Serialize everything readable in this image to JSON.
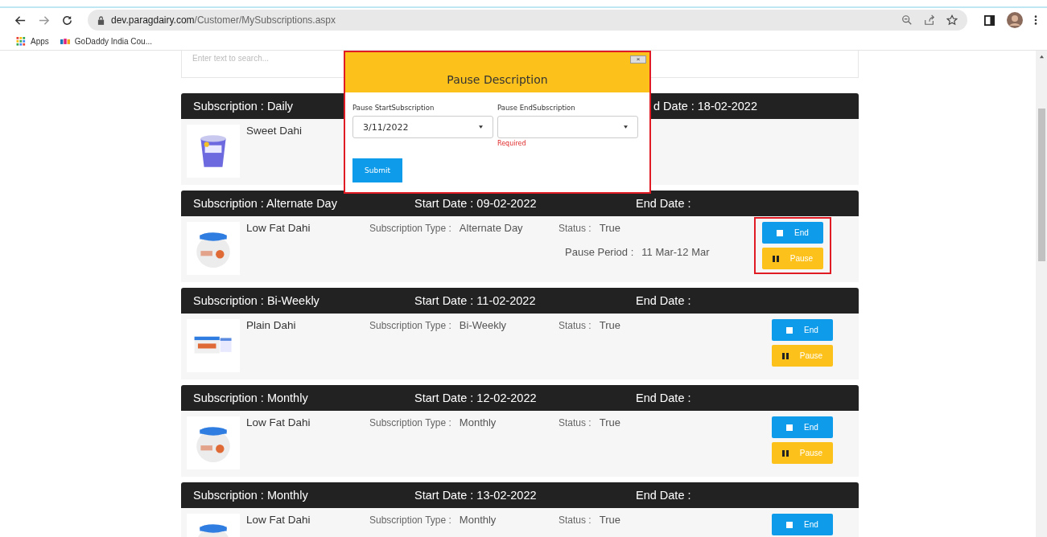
{
  "browser": {
    "url_host": "dev.paragdairy.com",
    "url_path": "/Customer/MySubscriptions.aspx",
    "bookmarks": [
      {
        "label": "Apps",
        "kind": "apps"
      },
      {
        "label": "GoDaddy India Cou...",
        "kind": "site"
      }
    ]
  },
  "search": {
    "placeholder": "Enter text to search..."
  },
  "subscriptions": [
    {
      "header": {
        "subscription": "Subscription : Daily",
        "end": "d Date : 18-02-2022",
        "cut_by_modal": true
      },
      "kind": "cup",
      "product": "Sweet Dahi"
    },
    {
      "header": {
        "subscription": "Subscription : Alternate Day",
        "start": "Start Date : 09-02-2022",
        "end": "End Date :",
        "cut_by_modal": false
      },
      "kind": "jar",
      "product": "Low Fat Dahi",
      "type_label": "Subscription Type :",
      "type_value": "Alternate Day",
      "status_label": "Status :",
      "status_value": "True",
      "pause_label": "Pause Period :",
      "pause_value": "11 Mar-12 Mar",
      "highlighted": true,
      "buttons": [
        {
          "label": "End",
          "kind": "end"
        },
        {
          "label": "Pause",
          "kind": "pause"
        }
      ]
    },
    {
      "header": {
        "subscription": "Subscription : Bi-Weekly",
        "start": "Start Date : 11-02-2022",
        "end": "End Date :",
        "cut_by_modal": false
      },
      "kind": "tubs",
      "product": "Plain Dahi",
      "type_label": "Subscription Type :",
      "type_value": "Bi-Weekly",
      "status_label": "Status :",
      "status_value": "True",
      "highlighted": false,
      "buttons": [
        {
          "label": "End",
          "kind": "end"
        },
        {
          "label": "Pause",
          "kind": "pause"
        }
      ]
    },
    {
      "header": {
        "subscription": "Subscription : Monthly",
        "start": "Start Date : 12-02-2022",
        "end": "End Date :",
        "cut_by_modal": false
      },
      "kind": "jar",
      "product": "Low Fat Dahi",
      "type_label": "Subscription Type :",
      "type_value": "Monthly",
      "status_label": "Status :",
      "status_value": "True",
      "highlighted": false,
      "buttons": [
        {
          "label": "End",
          "kind": "end"
        },
        {
          "label": "Pause",
          "kind": "pause"
        }
      ]
    },
    {
      "header": {
        "subscription": "Subscription : Monthly",
        "start": "Start Date : 13-02-2022",
        "end": "End Date :",
        "cut_by_modal": false
      },
      "kind": "jar",
      "product": "Low Fat Dahi",
      "type_label": "Subscription Type :",
      "type_value": "Monthly",
      "status_label": "Status :",
      "status_value": "True",
      "highlighted": false,
      "buttons": [
        {
          "label": "End",
          "kind": "end"
        }
      ]
    }
  ],
  "modal": {
    "close": "×",
    "title": "Pause Description",
    "fields": [
      {
        "label": "Pause StartSubscription",
        "value": "3/11/2022"
      },
      {
        "label": "Pause EndSubscription",
        "error": "Required"
      }
    ],
    "submit": "Submit"
  }
}
